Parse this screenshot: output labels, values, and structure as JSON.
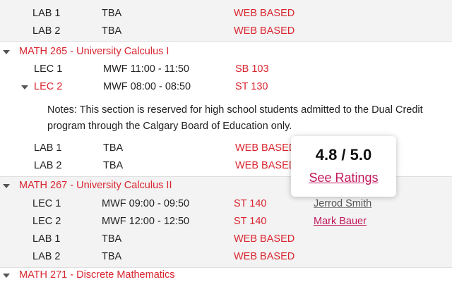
{
  "top_block": {
    "sections": [
      {
        "code": "LAB 1",
        "time": "TBA",
        "room": "WEB BASED"
      },
      {
        "code": "LAB 2",
        "time": "TBA",
        "room": "WEB BASED"
      }
    ]
  },
  "courses": [
    {
      "title": "MATH 265 - University Calculus I",
      "sections": [
        {
          "code": "LEC 1",
          "time": "MWF 11:00 - 11:50",
          "room": "SB 103"
        },
        {
          "code": "LEC 2",
          "time": "MWF 08:00 - 08:50",
          "room": "ST 130"
        },
        {
          "code": "LAB 1",
          "time": "TBA",
          "room": "WEB BASED"
        },
        {
          "code": "LAB 2",
          "time": "TBA",
          "room": "WEB BASED"
        }
      ],
      "notes": "Notes: This section is reserved for high school students admitted to the Dual Credit program through the Calgary Board of Education only."
    },
    {
      "title": "MATH 267 - University Calculus II",
      "sections": [
        {
          "code": "LEC 1",
          "time": "MWF 09:00 - 09:50",
          "room": "ST 140",
          "instructor": "Jerrod Smith"
        },
        {
          "code": "LEC 2",
          "time": "MWF 12:00 - 12:50",
          "room": "ST 140",
          "instructor": "Mark Bauer"
        },
        {
          "code": "LAB 1",
          "time": "TBA",
          "room": "WEB BASED"
        },
        {
          "code": "LAB 2",
          "time": "TBA",
          "room": "WEB BASED"
        }
      ]
    },
    {
      "title": "MATH 271 - Discrete Mathematics"
    }
  ],
  "popup": {
    "score": "4.8 / 5.0",
    "link_label": "See Ratings"
  },
  "colors": {
    "accent_red": "#d9252f",
    "link_pink": "#c2185b",
    "shaded_bg": "#f3f3f3"
  }
}
